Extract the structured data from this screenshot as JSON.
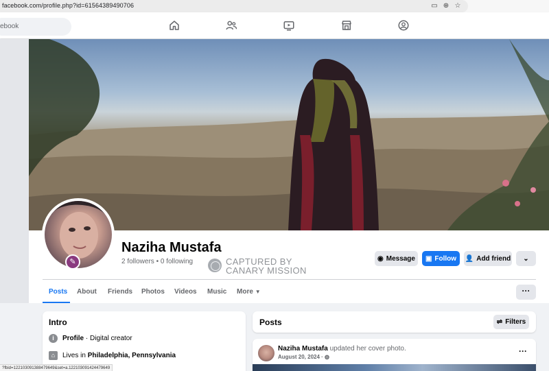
{
  "browser": {
    "url": "facebook.com/profile.php?id=61564389490706"
  },
  "search": {
    "placeholder": "ebook"
  },
  "profile": {
    "name": "Naziha Mustafa",
    "followers": "2 followers • 0 following"
  },
  "watermark": {
    "line1": "CAPTURED BY",
    "line2": "CANARY MISSION"
  },
  "actions": {
    "message": "Message",
    "follow": "Follow",
    "add_friend": "Add friend"
  },
  "tabs": [
    {
      "label": "Posts"
    },
    {
      "label": "About"
    },
    {
      "label": "Friends"
    },
    {
      "label": "Photos"
    },
    {
      "label": "Videos"
    },
    {
      "label": "Music"
    },
    {
      "label": "More"
    }
  ],
  "intro": {
    "title": "Intro",
    "profile_label": "Profile",
    "profile_rest": " · Digital creator",
    "lives_prefix": "Lives in ",
    "lives_place": "Philadelphia, Pennsylvania"
  },
  "posts": {
    "title": "Posts",
    "filters": "Filters",
    "author": "Naziha Mustafa",
    "action": " updated her cover photo.",
    "date": "August 20, 2024 ·"
  },
  "status_bar": {
    "url": "?fbid=122103091388479649&set=a.122103091424479649"
  },
  "colors": {
    "accent": "#1877f2",
    "background": "#f0f2f5"
  },
  "icons": [
    "home-icon",
    "friends-icon",
    "video-icon",
    "marketplace-icon",
    "groups-icon",
    "messenger-icon",
    "add-person-icon",
    "chevron-down-icon",
    "info-icon",
    "house-icon",
    "filter-icon"
  ]
}
